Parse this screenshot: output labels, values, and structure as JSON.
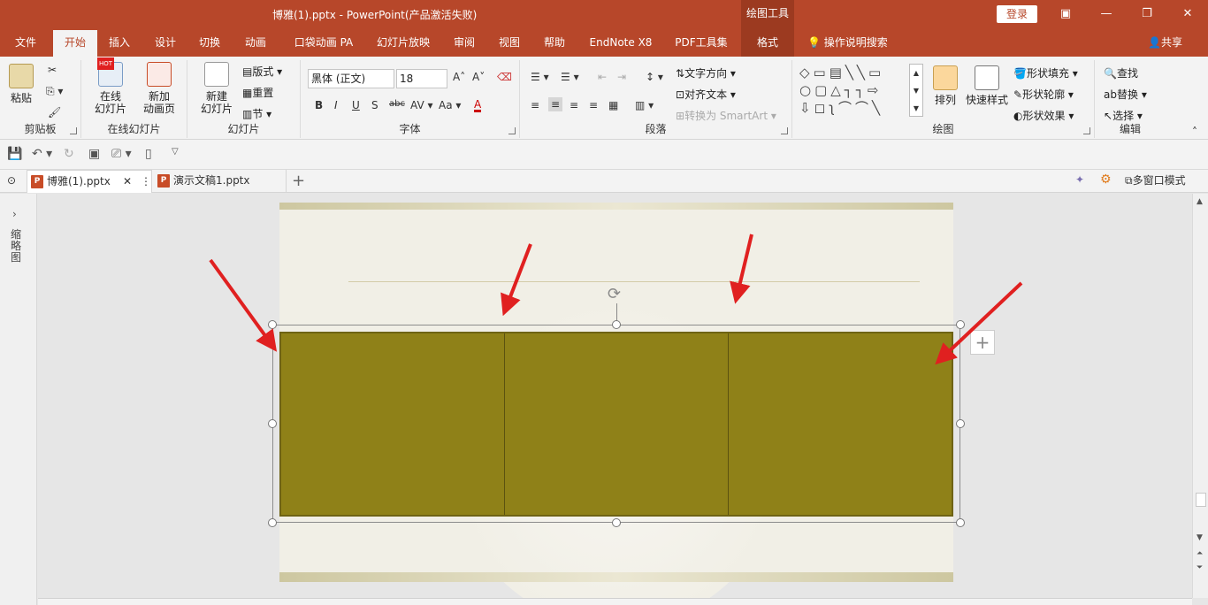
{
  "titlebar": {
    "title": "博雅(1).pptx  -  PowerPoint(产品激活失败)",
    "context_tab": "绘图工具",
    "login": "登录"
  },
  "ribbon_tabs": [
    "文件",
    "开始",
    "插入",
    "设计",
    "切换",
    "动画",
    "口袋动画 PA",
    "幻灯片放映",
    "审阅",
    "视图",
    "帮助",
    "EndNote X8",
    "PDF工具集",
    "格式"
  ],
  "ribbon_active_tab": "开始",
  "tellme": "操作说明搜索",
  "share": "共享",
  "groups": {
    "clipboard": {
      "label": "剪贴板",
      "paste": "粘贴"
    },
    "online_slides": {
      "label": "在线幻灯片",
      "online": "在线\n幻灯片",
      "new_anim": "新加\n动画页",
      "hot": "HOT"
    },
    "slides": {
      "label": "幻灯片",
      "new_slide": "新建\n幻灯片",
      "layout": "版式",
      "reset": "重置",
      "section": "节"
    },
    "font": {
      "label": "字体",
      "font_name": "黑体 (正文)",
      "font_size": "18"
    },
    "paragraph": {
      "label": "段落",
      "text_direction": "文字方向",
      "align_text": "对齐文本",
      "smartart": "转换为 SmartArt"
    },
    "drawing": {
      "label": "绘图",
      "arrange": "排列",
      "quick_styles": "快速样式",
      "fill": "形状填充",
      "outline": "形状轮廓",
      "effects": "形状效果"
    },
    "editing": {
      "label": "编辑",
      "find": "查找",
      "replace": "替换",
      "select": "选择"
    }
  },
  "doc_tabs": [
    {
      "name": "博雅(1).pptx",
      "active": true
    },
    {
      "name": "演示文稿1.pptx",
      "active": false
    }
  ],
  "multiwindow": "多窗口模式",
  "left_panel_label": "缩略图",
  "colors": {
    "brand": "#b7472a",
    "table_fill": "#8f8118",
    "arrow": "#e02020"
  }
}
